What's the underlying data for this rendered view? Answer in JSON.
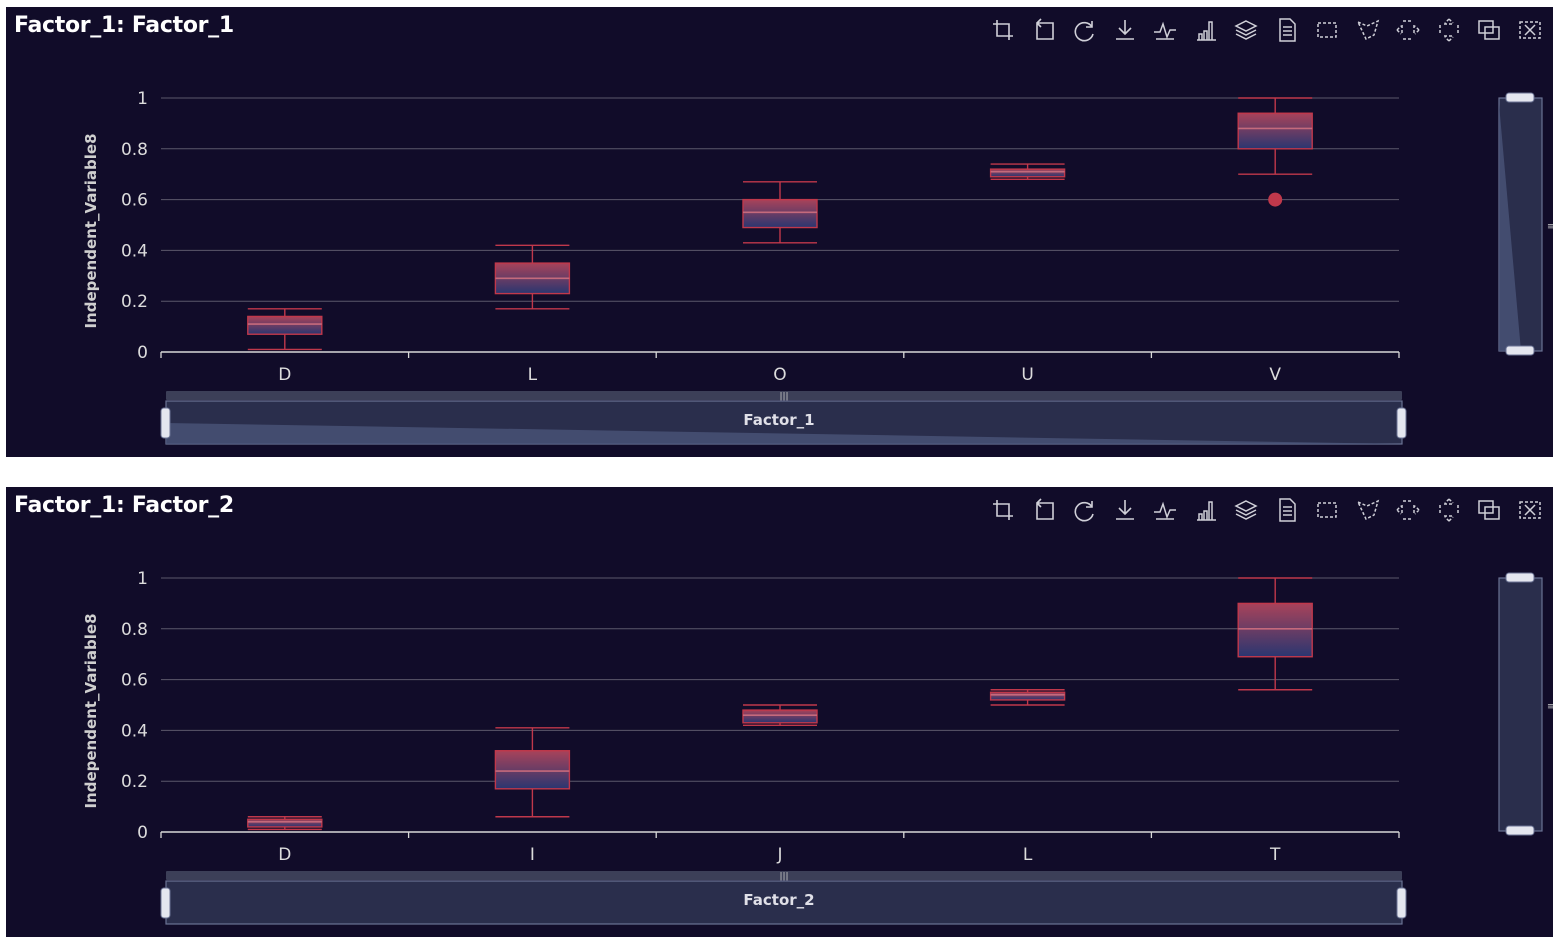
{
  "toolbar": {
    "icons": [
      "zoom-icon",
      "zoom-back-icon",
      "restore-icon",
      "download-icon",
      "line-chart-icon",
      "bar-chart-icon",
      "stack-icon",
      "data-view-icon",
      "rect-select-icon",
      "polygon-select-icon",
      "horizontal-select-icon",
      "vertical-select-icon",
      "keep-selection-icon",
      "clear-selection-icon"
    ]
  },
  "colors": {
    "background": "#110c29",
    "box_stroke": "#c0384b",
    "box_fill_top": "#a8435a",
    "box_fill_bottom": "#2a3670",
    "grid": "#5b586a",
    "axis": "#d8d8d8",
    "zoom_track": "#2a2e4c",
    "zoom_border": "#6b7394",
    "zoom_shadow": "#4a5478"
  },
  "chart_data": [
    {
      "type": "boxplot",
      "title": "Factor_1: Factor_1",
      "xlabel": "Factor_1",
      "ylabel": "Independent_Variable8",
      "ylim": [
        0,
        1
      ],
      "yticks": [
        "0",
        "0.2",
        "0.4",
        "0.6",
        "0.8",
        "1"
      ],
      "grid": true,
      "categories": [
        "D",
        "L",
        "O",
        "U",
        "V"
      ],
      "boxes": [
        {
          "min": 0.01,
          "q1": 0.07,
          "median": 0.11,
          "q3": 0.14,
          "max": 0.17
        },
        {
          "min": 0.17,
          "q1": 0.23,
          "median": 0.29,
          "q3": 0.35,
          "max": 0.42
        },
        {
          "min": 0.43,
          "q1": 0.49,
          "median": 0.55,
          "q3": 0.6,
          "max": 0.67
        },
        {
          "min": 0.68,
          "q1": 0.69,
          "median": 0.71,
          "q3": 0.72,
          "max": 0.74
        },
        {
          "min": 0.7,
          "q1": 0.8,
          "median": 0.88,
          "q3": 0.94,
          "max": 1.0
        }
      ],
      "outliers": [
        {
          "category": "V",
          "value": 0.6
        }
      ]
    },
    {
      "type": "boxplot",
      "title": "Factor_1: Factor_2",
      "xlabel": "Factor_2",
      "ylabel": "Independent_Variable8",
      "ylim": [
        0,
        1
      ],
      "yticks": [
        "0",
        "0.2",
        "0.4",
        "0.6",
        "0.8",
        "1"
      ],
      "grid": true,
      "categories": [
        "D",
        "I",
        "J",
        "L",
        "T"
      ],
      "boxes": [
        {
          "min": 0.01,
          "q1": 0.02,
          "median": 0.04,
          "q3": 0.05,
          "max": 0.06
        },
        {
          "min": 0.06,
          "q1": 0.17,
          "median": 0.24,
          "q3": 0.32,
          "max": 0.41
        },
        {
          "min": 0.42,
          "q1": 0.43,
          "median": 0.46,
          "q3": 0.48,
          "max": 0.5
        },
        {
          "min": 0.5,
          "q1": 0.52,
          "median": 0.54,
          "q3": 0.55,
          "max": 0.56
        },
        {
          "min": 0.56,
          "q1": 0.69,
          "median": 0.8,
          "q3": 0.9,
          "max": 1.0
        }
      ],
      "outliers": []
    }
  ]
}
